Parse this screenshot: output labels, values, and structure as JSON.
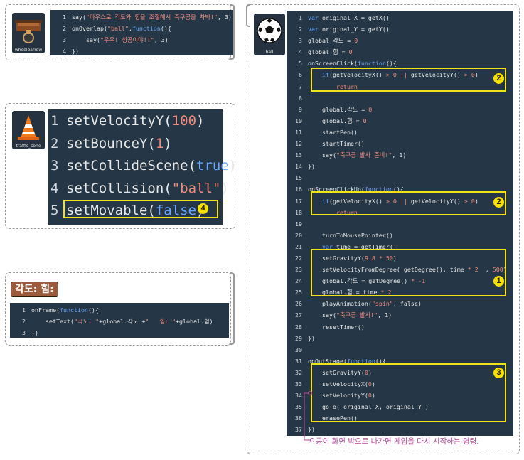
{
  "panels": {
    "wheelbarrow": {
      "sprite_name": "wheelbarrow",
      "lines": [
        {
          "n": "1",
          "parts": [
            [
              "fn",
              "say("
            ],
            [
              "str",
              "\"마우스로 각도와 힘을 조절해서 축구공을 차봐!\""
            ],
            [
              "fn",
              ", 3)"
            ]
          ]
        },
        {
          "n": "2",
          "parts": [
            [
              "fn",
              "onOverlap("
            ],
            [
              "str",
              "\"ball\""
            ],
            [
              "fn",
              ","
            ],
            [
              "kw",
              "function"
            ],
            [
              "fn",
              "(){"
            ]
          ]
        },
        {
          "n": "3",
          "parts": [
            [
              "fn",
              "    say("
            ],
            [
              "str",
              "\"우우! 성공이야!!\""
            ],
            [
              "fn",
              ", 3)"
            ]
          ]
        },
        {
          "n": "4",
          "parts": [
            [
              "fn",
              "})"
            ]
          ]
        }
      ]
    },
    "traffic_cone": {
      "sprite_name": "traffic_cone",
      "lines": [
        {
          "n": "1",
          "parts": [
            [
              "fn",
              "setVelocityY("
            ],
            [
              "num",
              "100"
            ],
            [
              "fn",
              ")"
            ]
          ]
        },
        {
          "n": "2",
          "parts": [
            [
              "fn",
              "setBounceY("
            ],
            [
              "num",
              "1"
            ],
            [
              "fn",
              ")"
            ]
          ]
        },
        {
          "n": "3",
          "parts": [
            [
              "fn",
              "setCollideScene("
            ],
            [
              "kw",
              "true"
            ],
            [
              "fn",
              ")"
            ]
          ]
        },
        {
          "n": "4",
          "parts": [
            [
              "fn",
              "setCollision("
            ],
            [
              "str",
              "\"ball\""
            ],
            [
              "fn",
              ")"
            ]
          ]
        },
        {
          "n": "5",
          "parts": [
            [
              "fn",
              "setMovable("
            ],
            [
              "kw",
              "false"
            ],
            [
              "fn",
              ")"
            ]
          ]
        }
      ],
      "badge": "4"
    },
    "angle": {
      "title": "각도: 힘:",
      "lines": [
        {
          "n": "1",
          "parts": [
            [
              "fn",
              "onFrame("
            ],
            [
              "kw",
              "function"
            ],
            [
              "fn",
              "(){"
            ]
          ]
        },
        {
          "n": "2",
          "parts": [
            [
              "fn",
              "    setText("
            ],
            [
              "str",
              "\"각도: \""
            ],
            [
              "fn",
              "+global.각도 +"
            ],
            [
              "str",
              "\"   힘: \""
            ],
            [
              "fn",
              "+global.힘)"
            ]
          ]
        },
        {
          "n": "3",
          "parts": [
            [
              "fn",
              "})"
            ]
          ]
        }
      ]
    },
    "ball": {
      "sprite_name": "ball",
      "lines": [
        {
          "n": "1",
          "parts": [
            [
              "kw",
              "var "
            ],
            [
              "fn",
              "original_X = getX()"
            ]
          ]
        },
        {
          "n": "2",
          "parts": [
            [
              "kw",
              "var "
            ],
            [
              "fn",
              "original_Y = getY()"
            ]
          ]
        },
        {
          "n": "3",
          "parts": [
            [
              "fn",
              "global.각도 = "
            ],
            [
              "num",
              "0"
            ]
          ]
        },
        {
          "n": "4",
          "parts": [
            [
              "fn",
              "global.힘 = "
            ],
            [
              "num",
              "0"
            ]
          ]
        },
        {
          "n": "5",
          "parts": [
            [
              "fn",
              "onScreenClick("
            ],
            [
              "kw",
              "function"
            ],
            [
              "fn",
              "(){"
            ]
          ]
        },
        {
          "n": "6",
          "parts": [
            [
              "kw",
              "    if"
            ],
            [
              "fn",
              "(getVelocityX() "
            ],
            [
              "str",
              "> 0 || "
            ],
            [
              "fn",
              "getVelocityY() "
            ],
            [
              "str",
              "> 0"
            ],
            [
              "fn",
              ")"
            ]
          ]
        },
        {
          "n": "7",
          "parts": [
            [
              "str",
              "        return"
            ]
          ]
        },
        {
          "n": "8",
          "parts": []
        },
        {
          "n": "9",
          "parts": [
            [
              "fn",
              "    global.각도 = "
            ],
            [
              "num",
              "0"
            ]
          ]
        },
        {
          "n": "10",
          "parts": [
            [
              "fn",
              "    global.힘 = "
            ],
            [
              "num",
              "0"
            ]
          ]
        },
        {
          "n": "11",
          "parts": [
            [
              "fn",
              "    startPen()"
            ]
          ]
        },
        {
          "n": "12",
          "parts": [
            [
              "fn",
              "    startTimer()"
            ]
          ]
        },
        {
          "n": "13",
          "parts": [
            [
              "fn",
              "    say("
            ],
            [
              "str",
              "\"축구공 발사 준비!\""
            ],
            [
              "fn",
              ", 1)"
            ]
          ]
        },
        {
          "n": "14",
          "parts": [
            [
              "fn",
              "})"
            ]
          ]
        },
        {
          "n": "15",
          "parts": []
        },
        {
          "n": "16",
          "parts": [
            [
              "fn",
              "onScreenClickUp("
            ],
            [
              "kw",
              "function"
            ],
            [
              "fn",
              "(){"
            ]
          ]
        },
        {
          "n": "17",
          "parts": [
            [
              "kw",
              "    if"
            ],
            [
              "fn",
              "(getVelocityX() "
            ],
            [
              "str",
              "> 0 || "
            ],
            [
              "fn",
              "getVelocityY() "
            ],
            [
              "str",
              "> 0"
            ],
            [
              "fn",
              ")"
            ]
          ]
        },
        {
          "n": "18",
          "parts": [
            [
              "str",
              "        return"
            ]
          ]
        },
        {
          "n": "19",
          "parts": []
        },
        {
          "n": "20",
          "parts": [
            [
              "fn",
              "    turnToMousePointer()"
            ]
          ]
        },
        {
          "n": "21",
          "parts": [
            [
              "kw",
              "    var "
            ],
            [
              "fn",
              "time = getTimer()"
            ]
          ]
        },
        {
          "n": "22",
          "parts": [
            [
              "fn",
              "    setGravityY("
            ],
            [
              "num",
              "9.8 * 50"
            ],
            [
              "fn",
              ")"
            ]
          ]
        },
        {
          "n": "23",
          "parts": [
            [
              "fn",
              "    setVelocityFromDegree( getDegree(), time "
            ],
            [
              "num",
              "* 2"
            ],
            [
              "fn",
              "  , "
            ],
            [
              "num",
              "500"
            ],
            [
              "fn",
              ")"
            ]
          ]
        },
        {
          "n": "24",
          "parts": [
            [
              "fn",
              "    global.각도 = getDegree() "
            ],
            [
              "num",
              "* -1"
            ]
          ]
        },
        {
          "n": "25",
          "parts": [
            [
              "fn",
              "    global.힘 = time "
            ],
            [
              "num",
              "* 2"
            ]
          ]
        },
        {
          "n": "26",
          "parts": [
            [
              "fn",
              "    playAnimation("
            ],
            [
              "str",
              "\"spin\""
            ],
            [
              "fn",
              ", false)"
            ]
          ]
        },
        {
          "n": "27",
          "parts": [
            [
              "fn",
              "    say("
            ],
            [
              "str",
              "\"축구공 발사!\""
            ],
            [
              "fn",
              ", 1)"
            ]
          ]
        },
        {
          "n": "28",
          "parts": [
            [
              "fn",
              "    resetTimer()"
            ]
          ]
        },
        {
          "n": "29",
          "parts": [
            [
              "fn",
              "})"
            ]
          ]
        },
        {
          "n": "30",
          "parts": []
        },
        {
          "n": "31",
          "parts": [
            [
              "fn",
              "onOutStage("
            ],
            [
              "kw",
              "function"
            ],
            [
              "fn",
              "(){"
            ]
          ]
        },
        {
          "n": "32",
          "parts": [
            [
              "fn",
              "    setGravityY("
            ],
            [
              "num",
              "0"
            ],
            [
              "fn",
              ")"
            ]
          ]
        },
        {
          "n": "33",
          "parts": [
            [
              "fn",
              "    setVelocityX("
            ],
            [
              "num",
              "0"
            ],
            [
              "fn",
              ")"
            ]
          ]
        },
        {
          "n": "34",
          "parts": [
            [
              "fn",
              "    setVelocityY("
            ],
            [
              "num",
              "0"
            ],
            [
              "fn",
              ")"
            ]
          ]
        },
        {
          "n": "35",
          "parts": [
            [
              "fn",
              "    goTo( original_X, original_Y )"
            ]
          ]
        },
        {
          "n": "36",
          "parts": [
            [
              "fn",
              "    erasePen()"
            ]
          ]
        },
        {
          "n": "37",
          "parts": [
            [
              "fn",
              "})"
            ]
          ]
        }
      ],
      "badges": {
        "b2a": "2",
        "b2b": "2",
        "b1": "1",
        "b3": "3"
      },
      "annotation": "공이 화면 밖으로 나가면 게임을 다시 시작하는 명령."
    }
  },
  "colors": {
    "editor_bg": "#253746",
    "keyword": "#6aa7ff",
    "string": "#f08a7a",
    "highlight": "#f2e21a",
    "annotation": "#b4489a"
  }
}
